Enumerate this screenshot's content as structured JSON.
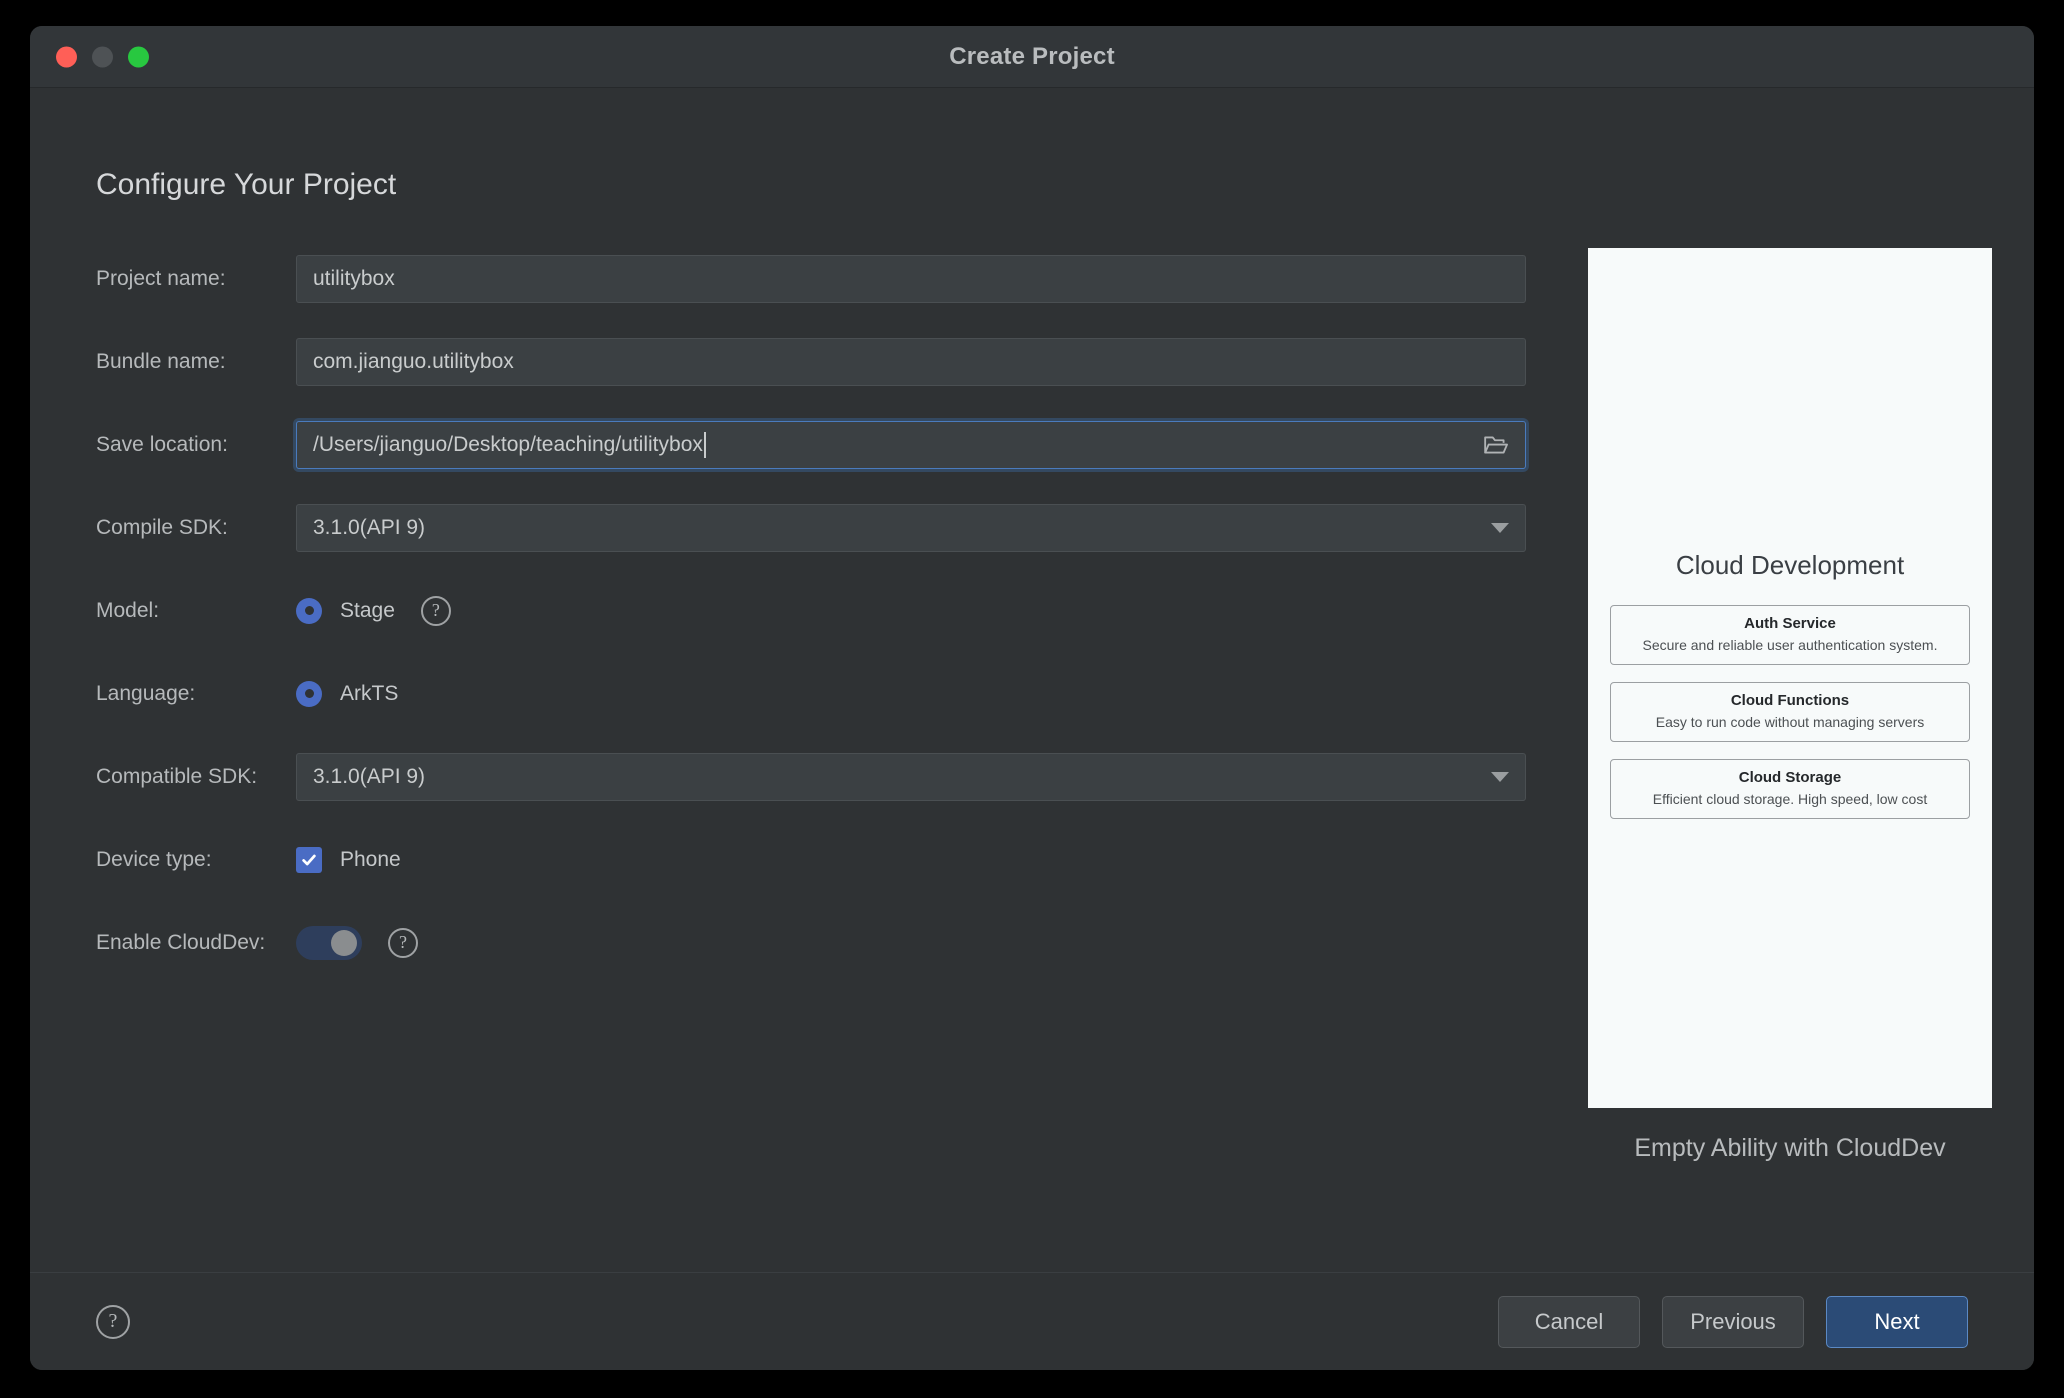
{
  "window": {
    "title": "Create Project",
    "traffic_lights": [
      "close-button",
      "minimize-button",
      "zoom-button"
    ]
  },
  "page": {
    "heading": "Configure Your Project"
  },
  "form": {
    "project_name": {
      "label": "Project name:",
      "value": "utilitybox",
      "placeholder": "Project name"
    },
    "bundle_name": {
      "label": "Bundle name:",
      "value": "com.jianguo.utilitybox",
      "placeholder": "Bundle name"
    },
    "save_location": {
      "label": "Save location:",
      "value": "/Users/jianguo/Desktop/teaching/utilitybox",
      "placeholder": "Save location",
      "browse_icon": "folder-open-icon",
      "focused": true
    },
    "compile_sdk": {
      "label": "Compile SDK:",
      "value": "3.1.0(API 9)",
      "arrow_icon": "chevron-down-icon"
    },
    "model": {
      "label": "Model:",
      "option": "Stage",
      "selected": true,
      "help_icon": "help-circle-icon",
      "help_glyph": "?"
    },
    "language": {
      "label": "Language:",
      "option": "ArkTS",
      "selected": true
    },
    "compatible_sdk": {
      "label": "Compatible SDK:",
      "value": "3.1.0(API 9)",
      "arrow_icon": "chevron-down-icon"
    },
    "device_type": {
      "label": "Device type:",
      "option": "Phone",
      "checked": true,
      "check_icon": "checkmark-icon"
    },
    "enable_clouddev": {
      "label": "Enable CloudDev:",
      "enabled": true,
      "help_icon": "help-circle-icon",
      "help_glyph": "?"
    }
  },
  "preview": {
    "title": "Cloud Development",
    "features": [
      {
        "title": "Auth Service",
        "desc": "Secure and reliable user authentication system."
      },
      {
        "title": "Cloud Functions",
        "desc": "Easy to run code without managing servers"
      },
      {
        "title": "Cloud Storage",
        "desc": "Efficient cloud storage. High speed, low cost"
      }
    ],
    "caption": "Empty Ability with CloudDev"
  },
  "footer": {
    "help_icon": "help-circle-icon",
    "help_glyph": "?",
    "cancel_label": "Cancel",
    "previous_label": "Previous",
    "next_label": "Next"
  },
  "colors": {
    "window_bg": "#2f3234",
    "titlebar_bg": "#323639",
    "field_bg": "#3b4043",
    "accent_blue": "#4a6cc4",
    "primary_button": "#2b4b76",
    "focus_border": "#4a7bbd",
    "toggle_on_track": "#2e3e5c",
    "preview_bg": "#f7fafa",
    "close_light": "#ff5f57",
    "minimize_light": "#4e5255",
    "zoom_light": "#28c840"
  }
}
